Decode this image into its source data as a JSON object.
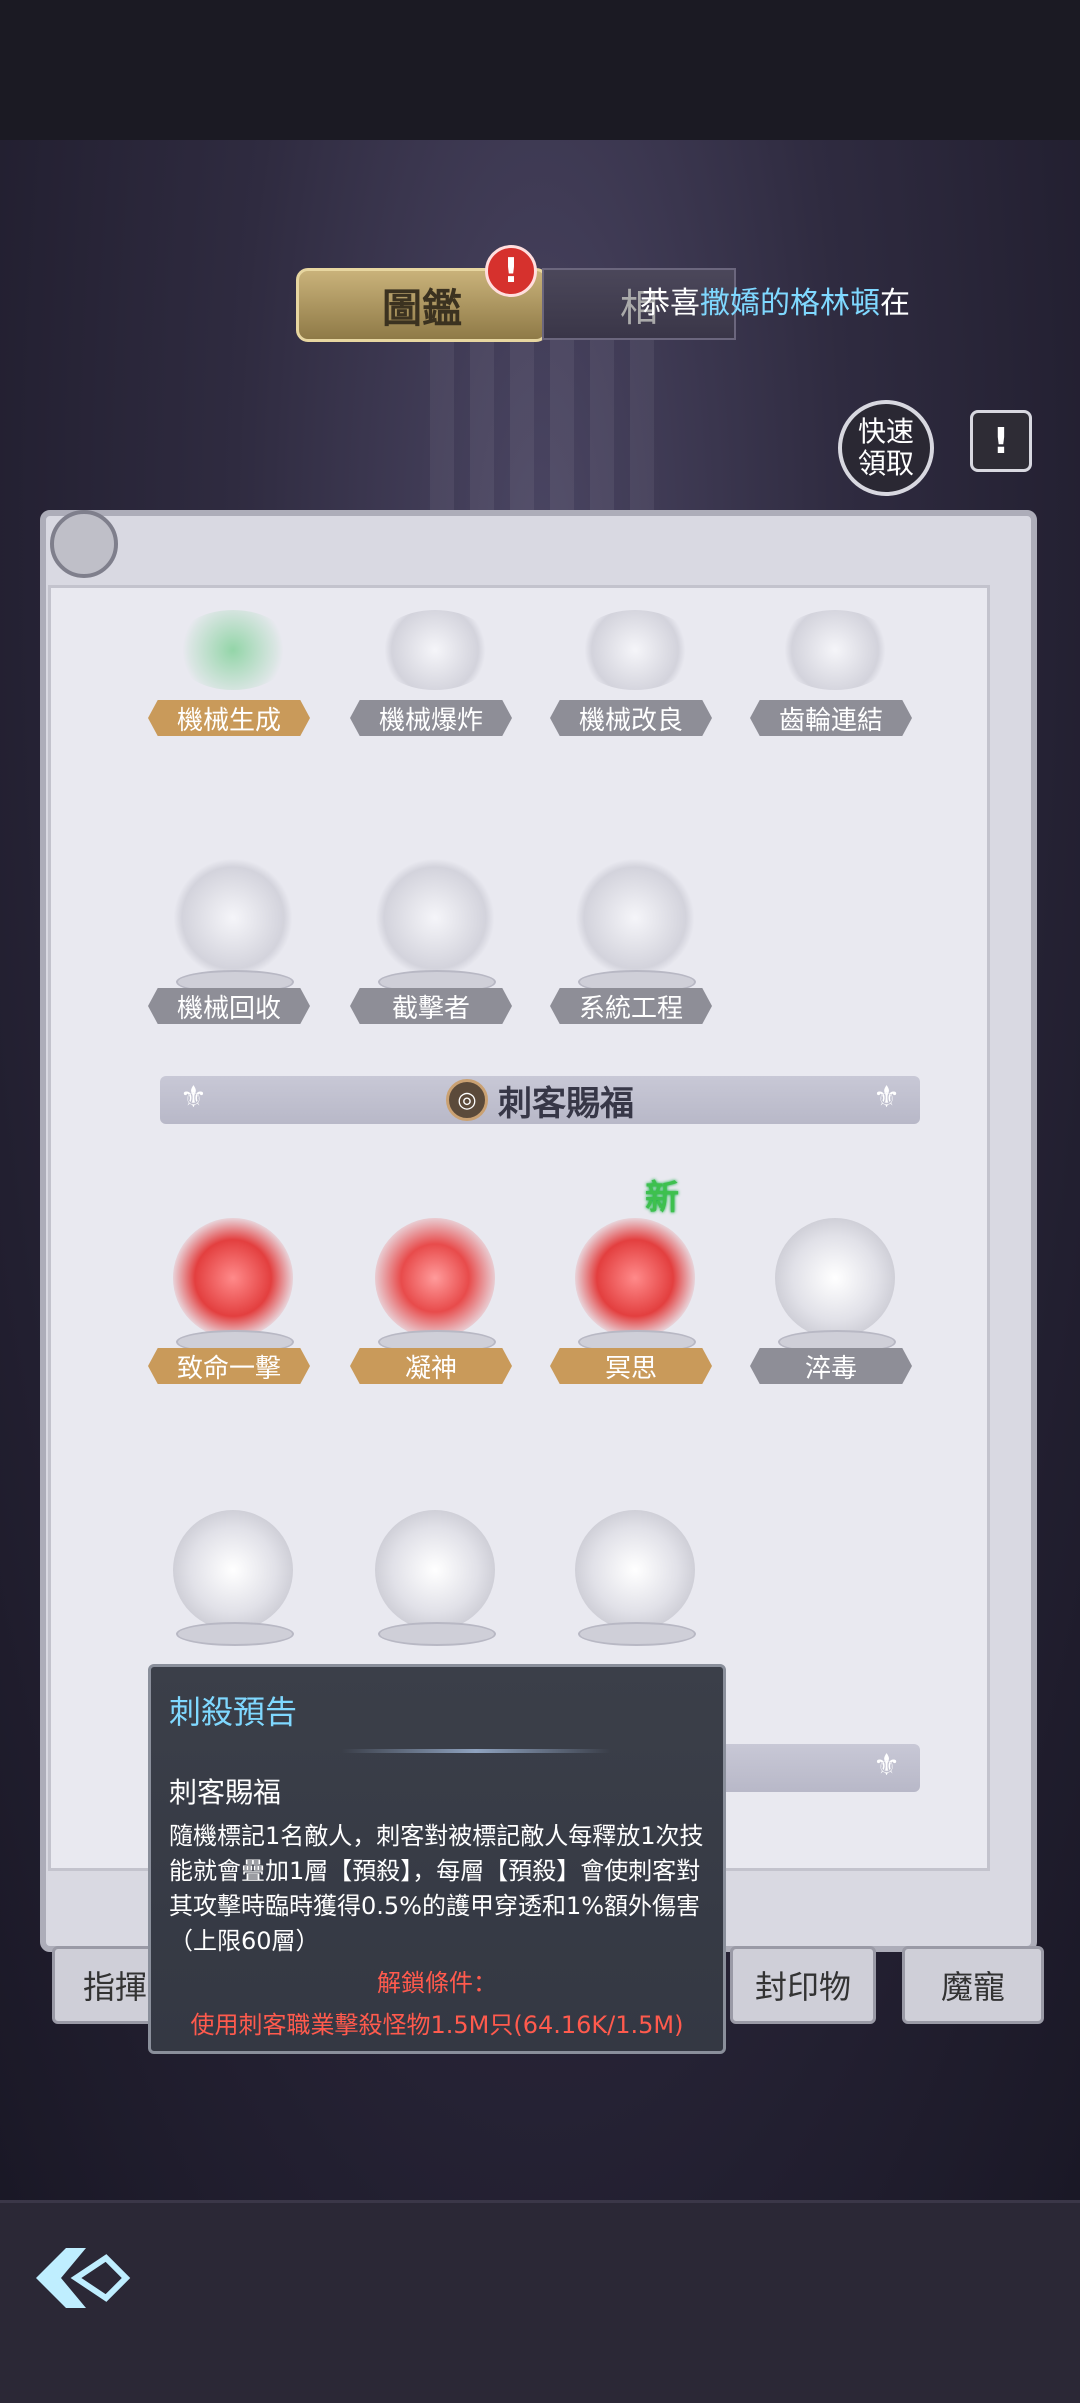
{
  "header": {
    "tab_active": "圖鑑",
    "tab_alert": "!",
    "tab_second": "相",
    "ticker_prefix": "恭喜",
    "ticker_name": "撒嬌的格林頓",
    "ticker_suffix": "在",
    "quick_claim": "快速領取",
    "info_icon": "!"
  },
  "skills_row1": [
    "機械生成",
    "機械爆炸",
    "機械改良",
    "齒輪連結"
  ],
  "skills_row2": [
    "機械回收",
    "截擊者",
    "系統工程"
  ],
  "section": {
    "title": "刺客賜福",
    "new_badge": "新"
  },
  "skills_row3": [
    "致命一擊",
    "凝神",
    "冥思",
    "淬毒"
  ],
  "bottom_tabs": {
    "left": "指揮",
    "right1": "封印物",
    "right2": "魔寵"
  },
  "tooltip": {
    "title": "刺殺預告",
    "category": "刺客賜福",
    "description": "隨機標記1名敵人，刺客對被標記敵人每釋放1次技能就會疊加1層【預殺】，每層【預殺】會使刺客對其攻擊時臨時獲得0.5%的護甲穿透和1%額外傷害（上限60層）",
    "unlock_label": "解鎖條件：",
    "unlock_condition": "使用刺客職業擊殺怪物1.5M只(64.16K/1.5M)"
  },
  "colors": {
    "gold_label": "#c99a5a",
    "grey_label": "#8e8e97",
    "tooltip_title": "#7fd8ff",
    "unlock_red": "#ff5a4d",
    "new_green": "#3ec04e"
  }
}
